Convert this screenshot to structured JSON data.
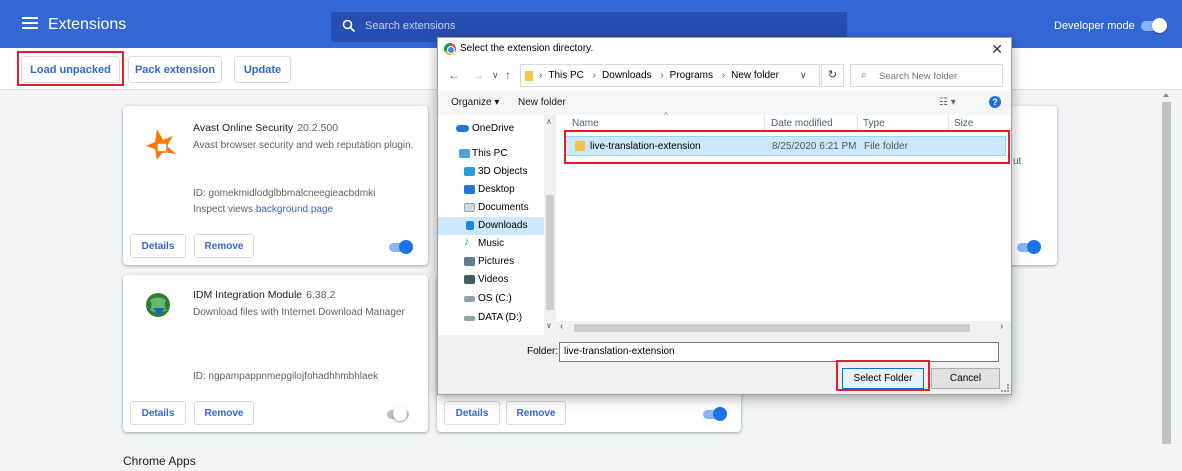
{
  "header": {
    "title": "Extensions",
    "search_placeholder": "Search extensions",
    "developer_mode_label": "Developer mode"
  },
  "toolbar": {
    "load_unpacked": "Load unpacked",
    "pack_extension": "Pack extension",
    "update": "Update"
  },
  "extensions": [
    {
      "name": "Avast Online Security",
      "version": "20.2.500",
      "description": "Avast browser security and web reputation plugin.",
      "id": "ID: gomekmidlodglbbmalcneegieacbdmki",
      "inspect_prefix": "Inspect views",
      "inspect_link": "background page",
      "details": "Details",
      "remove": "Remove",
      "enabled": true
    },
    {
      "name": "IDM Integration Module",
      "version": "6.38.2",
      "description": "Download files with Internet Download Manager",
      "id": "ID: ngpampappnmepgilojfohadhhmbhlaek",
      "details": "Details",
      "remove": "Remove",
      "enabled": false
    },
    {
      "details": "Details",
      "remove": "Remove",
      "enabled": true
    }
  ],
  "partial_card_text": "ut",
  "section_title": "Chrome Apps",
  "dialog": {
    "title": "Select the extension directory.",
    "breadcrumbs": [
      "This PC",
      "Downloads",
      "Programs",
      "New folder"
    ],
    "search_placeholder": "Search New folder",
    "organize": "Organize ▾",
    "new_folder": "New folder",
    "nav_items": [
      "OneDrive",
      "This PC",
      "3D Objects",
      "Desktop",
      "Documents",
      "Downloads",
      "Music",
      "Pictures",
      "Videos",
      "OS (C:)",
      "DATA (D:)"
    ],
    "columns": [
      "Name",
      "Date modified",
      "Type",
      "Size"
    ],
    "file": {
      "name": "live-translation-extension",
      "date": "8/25/2020 6:21 PM",
      "type": "File folder"
    },
    "folder_label": "Folder:",
    "folder_value": "live-translation-extension",
    "select_button": "Select Folder",
    "cancel_button": "Cancel"
  }
}
